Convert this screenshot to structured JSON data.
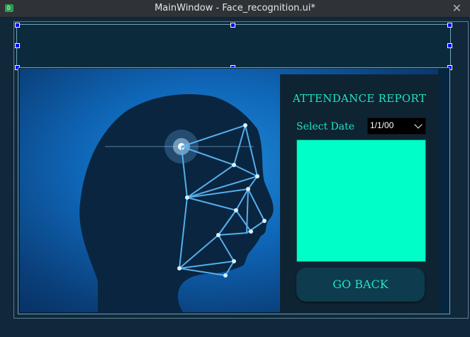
{
  "window": {
    "title": "MainWindow - Face_recognition.ui*",
    "app_icon_letter": "D"
  },
  "panel": {
    "title": "ATTENDANCE REPORT",
    "date_label": "Select Date",
    "date_value": "1/1/00",
    "report_box_color": "#00ffc8",
    "go_back_label": "GO BACK"
  },
  "colors": {
    "accent_text": "#1ee3c2",
    "panel_bg": "#0f2433",
    "button_bg": "#0e3b4d",
    "selection_handle": "#0000ff"
  }
}
